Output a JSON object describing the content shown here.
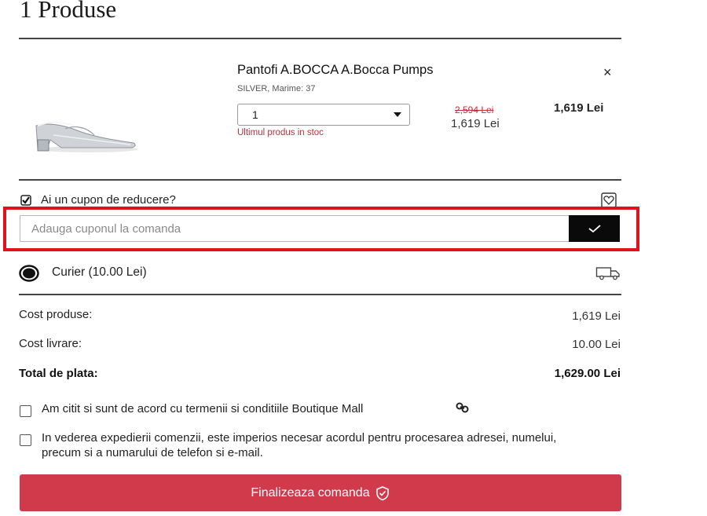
{
  "cart": {
    "title": "1 Produse"
  },
  "product": {
    "name": "Pantofi A.BOCCA A.Bocca Pumps",
    "variant": "SILVER, Marime: 37",
    "quantity": "1",
    "stock_note": "Ultimul produs in stoc",
    "old_price": "2,594 Lei",
    "unit_price": "1,619 Lei",
    "line_total": "1,619 Lei",
    "remove_glyph": "×"
  },
  "coupon": {
    "checkbox_label": "Ai un cupon de reducere?",
    "checked": true,
    "placeholder": "Adauga cuponul la comanda"
  },
  "shipping": {
    "label": "Curier (10.00 Lei)",
    "selected": true
  },
  "totals": {
    "products_label": "Cost produse:",
    "products_value": "1,619 Lei",
    "delivery_label": "Cost livrare:",
    "delivery_value": "10.00 Lei",
    "total_label": "Total de plata:",
    "total_value": "1,629.00 Lei"
  },
  "terms": {
    "agree_text": "Am citit si sunt de acord cu termenii si conditiile Boutique Mall",
    "consent_text": "In vederea expedierii comenzii, este imperios necesar acordul pentru procesarea adresei, numelui, precum si a numarului de telefon si e-mail."
  },
  "checkout": {
    "button_label": "Finalizeaza comanda"
  },
  "colors": {
    "accent_red": "#d13a4b",
    "highlight_border": "#e0131c",
    "stock_red": "#c0303a",
    "dark": "#0a0a0a"
  },
  "icons": [
    "close-icon",
    "checkbox-checked-icon",
    "heart-tag-icon",
    "checkmark-icon",
    "radio-selected-icon",
    "truck-icon",
    "link-icon",
    "shield-check-icon",
    "chevron-down-icon"
  ]
}
